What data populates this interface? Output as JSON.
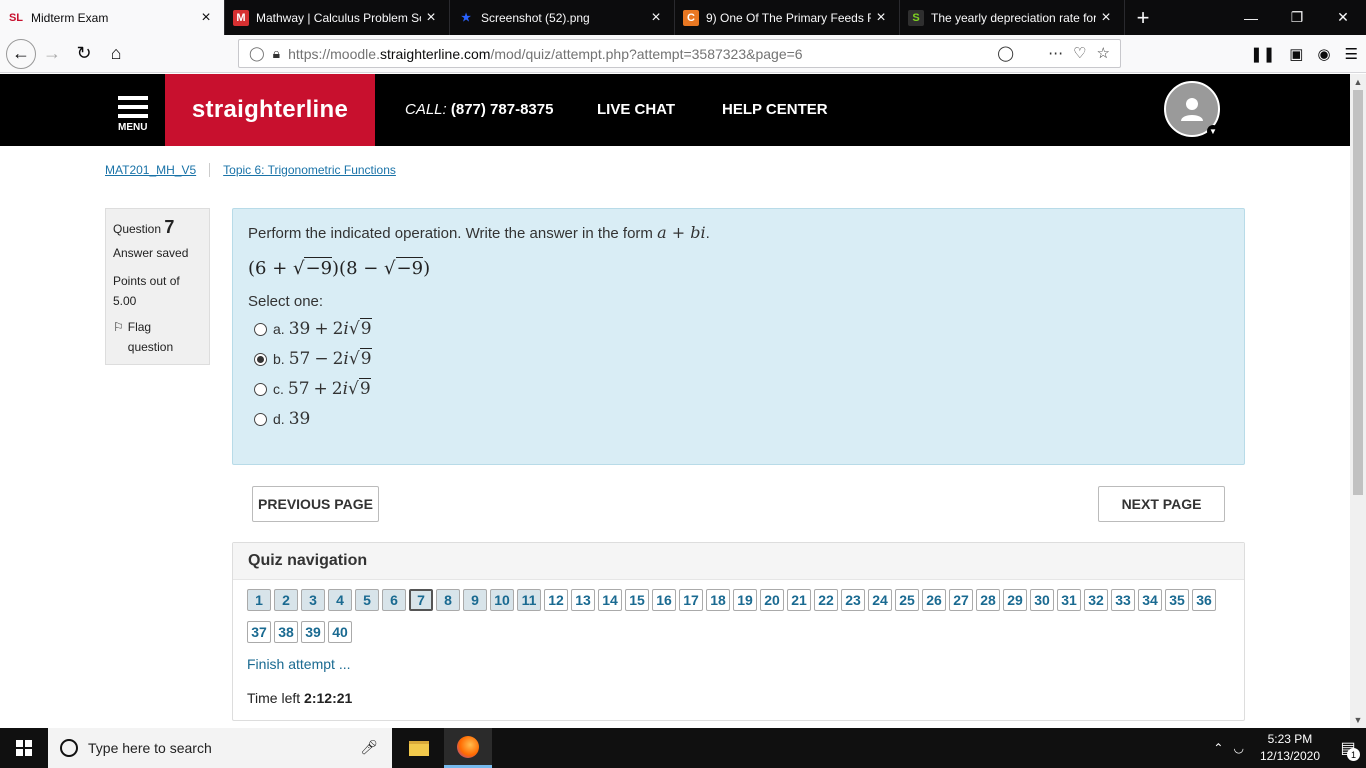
{
  "browser": {
    "tabs": [
      {
        "title": "Midterm Exam",
        "favicon": "SL",
        "fav_color": "#c8102e",
        "active": true
      },
      {
        "title": "Mathway | Calculus Problem Sc",
        "favicon": "M",
        "fav_color": "#d63031",
        "active": false
      },
      {
        "title": "Screenshot (52).png",
        "favicon": "★",
        "fav_color": "#2962ff",
        "active": false
      },
      {
        "title": "9) One Of The Primary Feeds Fo",
        "favicon": "C",
        "fav_color": "#e87722",
        "active": false
      },
      {
        "title": "The yearly depreciation rate for",
        "favicon": "S",
        "fav_color": "#7ed321",
        "active": false
      }
    ],
    "url_prefix": "https://moodle.",
    "url_host": "straighterline.com",
    "url_path": "/mod/quiz/attempt.php?attempt=3587323&page=6"
  },
  "site": {
    "brand": "straighterline",
    "menu_label": "MENU",
    "call_label": "CALL:",
    "call_number": "(877) 787-8375",
    "live_chat": "LIVE CHAT",
    "help_center": "HELP CENTER"
  },
  "breadcrumb": {
    "course": "MAT201_MH_V5",
    "topic": "Topic 6: Trigonometric Functions"
  },
  "question_info": {
    "label": "Question",
    "number": "7",
    "state": "Answer saved",
    "points": "Points out of 5.00",
    "flag": "Flag question"
  },
  "question": {
    "text": "Perform the indicated operation. Write the answer in the form",
    "prompt": "Select one:",
    "options": [
      {
        "letter": "a.",
        "value_a": "39",
        "op": "+",
        "checked": false
      },
      {
        "letter": "b.",
        "value_a": "57",
        "op": "−",
        "checked": true
      },
      {
        "letter": "c.",
        "value_a": "57",
        "op": "+",
        "checked": false
      },
      {
        "letter": "d.",
        "value_a": "39",
        "op": "",
        "checked": false
      }
    ]
  },
  "nav": {
    "previous": "PREVIOUS PAGE",
    "next": "NEXT PAGE"
  },
  "quiz_nav": {
    "title": "Quiz navigation",
    "current": 7,
    "answered_up_to": 11,
    "total": 40,
    "finish": "Finish attempt ...",
    "time_label": "Time left",
    "time_value": "2:12:21"
  },
  "taskbar": {
    "search_placeholder": "Type here to search",
    "time": "5:23 PM",
    "date": "12/13/2020",
    "notifications": "1"
  }
}
